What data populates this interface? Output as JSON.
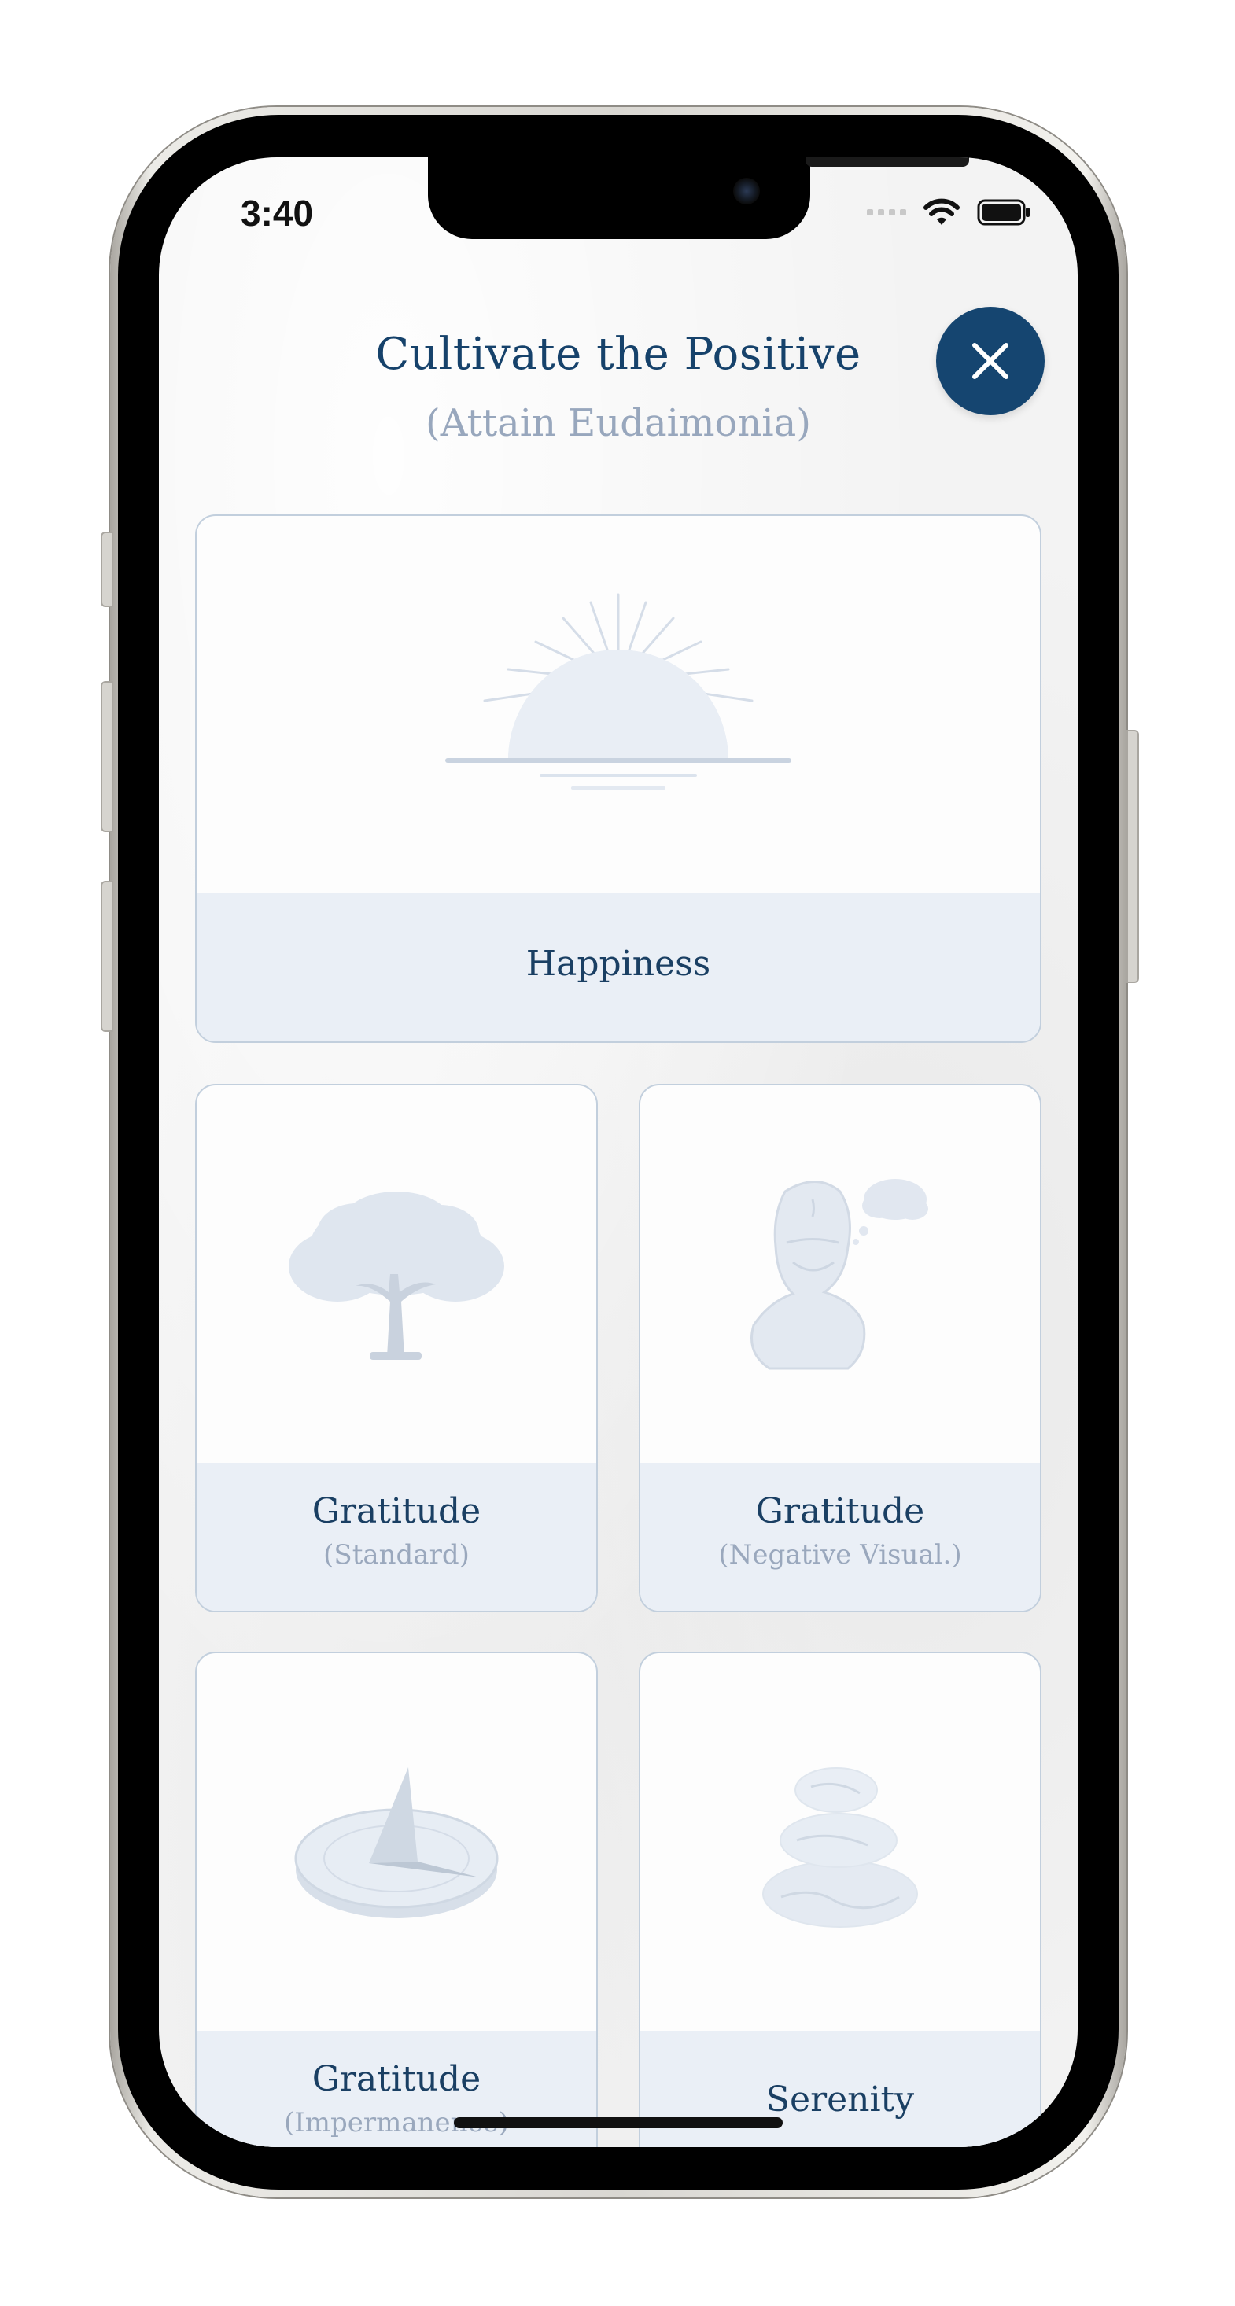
{
  "status_bar": {
    "time": "3:40"
  },
  "header": {
    "title": "Cultivate the Positive",
    "subtitle": "(Attain Eudaimonia)",
    "close_icon": "close-icon"
  },
  "cards": [
    {
      "label": "Happiness",
      "sublabel": "",
      "icon": "sunrise-icon"
    },
    {
      "label": "Gratitude",
      "sublabel": "(Standard)",
      "icon": "tree-icon"
    },
    {
      "label": "Gratitude",
      "sublabel": "(Negative Visual.)",
      "icon": "philosopher-bust-icon"
    },
    {
      "label": "Gratitude",
      "sublabel": "(Impermanence)",
      "icon": "sundial-icon"
    },
    {
      "label": "Serenity",
      "sublabel": "",
      "icon": "stacked-stones-icon"
    }
  ],
  "colors": {
    "accent": "#154570",
    "title": "#16426b",
    "subtitle": "#98a7bd",
    "card_label_bg": "#eaeff6",
    "card_border": "#c2cfdd",
    "illustration": "#dfe6ef"
  }
}
